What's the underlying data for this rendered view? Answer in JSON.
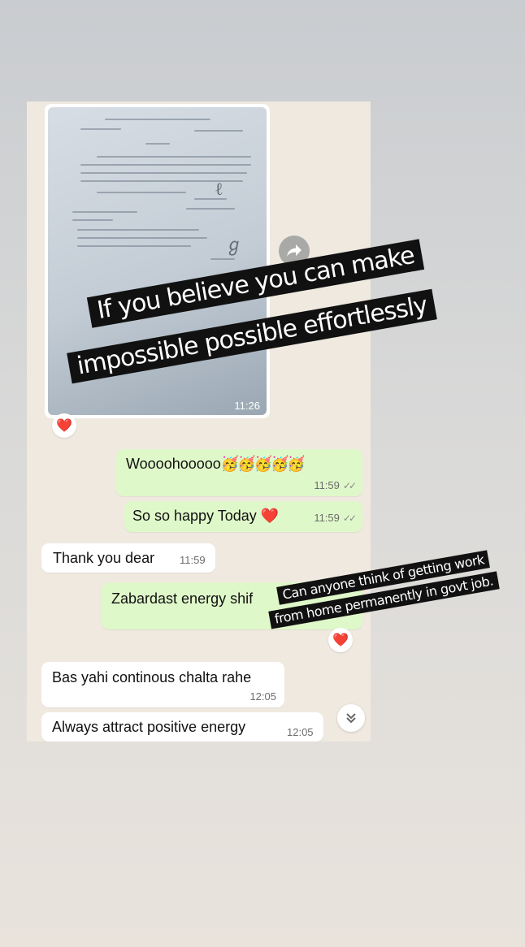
{
  "chat": {
    "image_message": {
      "time": "11:26",
      "reaction": "❤️"
    },
    "messages": [
      {
        "direction": "out",
        "text": "Wooooho oooo",
        "display": "Woooohooooo",
        "emoji": "🥳🥳🥳🥳🥳",
        "time": "11:59",
        "ticks": "✓✓"
      },
      {
        "direction": "out",
        "text": "So so happy Today",
        "emoji": "❤️",
        "time": "11:59",
        "ticks": "✓✓"
      },
      {
        "direction": "in",
        "text": "Thank you dear",
        "time": "11:59"
      },
      {
        "direction": "out",
        "text": "Zabardast energy shif",
        "reaction": "❤️"
      },
      {
        "direction": "in",
        "text": "Bas yahi continous chalta rahe",
        "time": "12:05"
      },
      {
        "direction": "in",
        "text": "Always attract positive energy",
        "time": "12:05"
      }
    ]
  },
  "overlays": {
    "quote_line1": "If you believe you can make",
    "quote_line2": "impossible possible effortlessly",
    "question_line1": "Can anyone think of getting work",
    "question_line2": "from home permanently in govt job."
  },
  "icons": {
    "forward": "forward-arrow-icon",
    "scroll_down": "double-chevron-down-icon",
    "heart": "heart-icon"
  }
}
